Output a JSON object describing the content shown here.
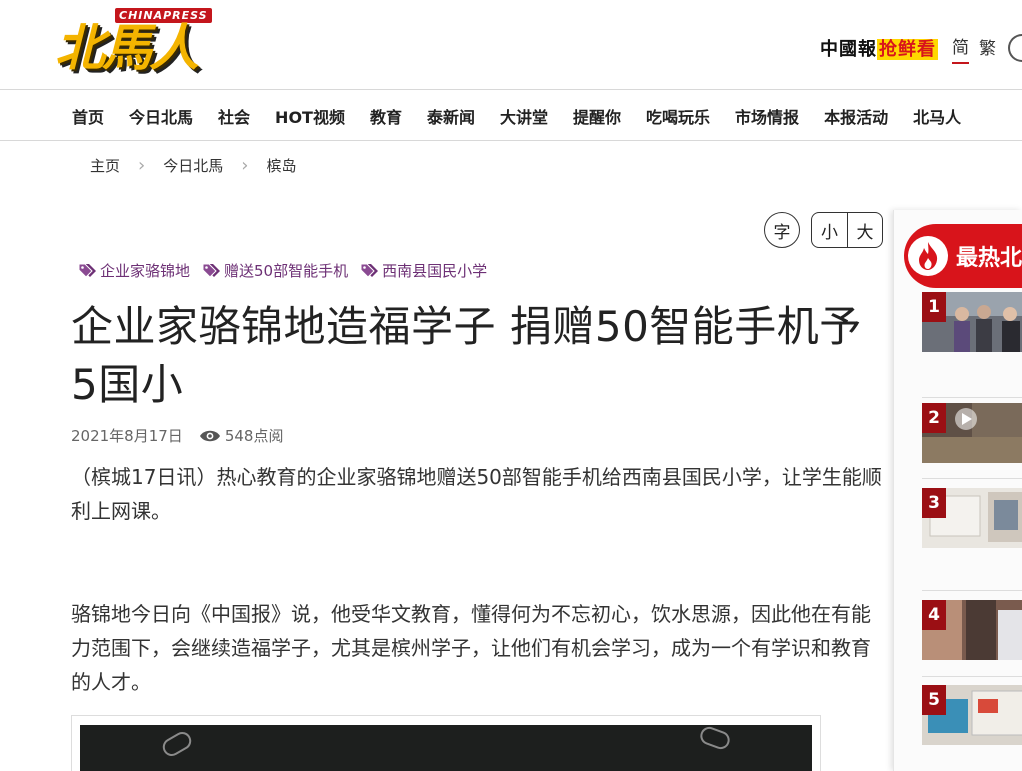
{
  "header": {
    "logo_en": "CHINAPRESS",
    "logo_cn": "北馬人",
    "brand": "中國報",
    "brand_hot": "抢鲜看",
    "lang_simplified": "简",
    "lang_traditional": "繁"
  },
  "nav": {
    "items": [
      "首页",
      "今日北馬",
      "社会",
      "HOT视频",
      "教育",
      "泰新闻",
      "大讲堂",
      "提醒你",
      "吃喝玩乐",
      "市场情报",
      "本报活动",
      "北马人"
    ]
  },
  "breadcrumb": [
    "主页",
    "今日北馬",
    "槟岛"
  ],
  "font_controls": {
    "zi": "字",
    "small": "小",
    "large": "大"
  },
  "tags": [
    "企业家骆锦地",
    "赠送50部智能手机",
    "西南县国民小学"
  ],
  "article": {
    "title": "企业家骆锦地造福学子 捐赠50智能手机予5国小",
    "date": "2021年8月17日",
    "views": "548点阅",
    "p1": "（槟城17日讯）热心教育的企业家骆锦地赠送50部智能手机给西南县国民小学，让学生能顺利上网课。",
    "p2": "骆锦地今日向《中国报》说，他受华文教育，懂得何为不忘初心，饮水思源，因此他在有能力范围下，会继续造福学子，尤其是槟州学子，让他们有机会学习，成为一个有学识和教育的人才。"
  },
  "sidebar": {
    "title": "最热北",
    "ranks": [
      "1",
      "2",
      "3",
      "4",
      "5"
    ]
  },
  "colors": {
    "brand_red": "#d8141b",
    "tag_purple": "#6d3075",
    "rank_red": "#9b0f14"
  }
}
